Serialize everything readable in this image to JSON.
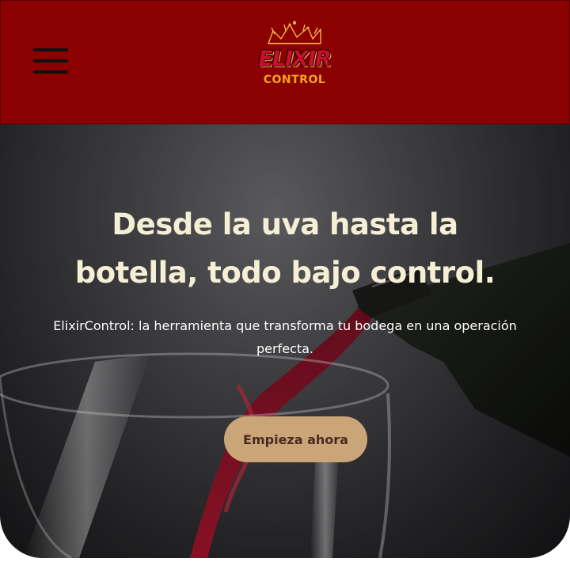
{
  "header": {
    "brand_name": "ELIXIR",
    "brand_subtitle": "CONTROL",
    "menu_icon": "hamburger-icon",
    "logo_icon": "crown-icon"
  },
  "hero": {
    "title": "Desde la uva hasta la botella, todo bajo control.",
    "subtitle": "ElixirControl: la herramienta que transforma tu bodega en una operación perfecta.",
    "cta_label": "Empieza ahora"
  },
  "colors": {
    "header_bg": "#8b0000",
    "title_text": "#f5efd6",
    "cta_bg": "#c9a577",
    "cta_text": "#4a2a20",
    "logo_gold": "#f2a51a",
    "logo_red": "#c8102e"
  }
}
